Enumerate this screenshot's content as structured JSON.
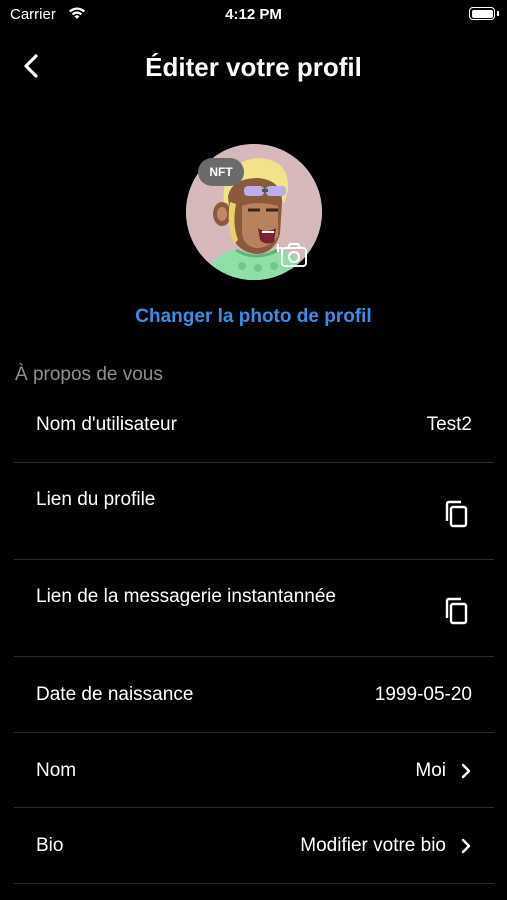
{
  "status": {
    "carrier": "Carrier",
    "time": "4:12 PM"
  },
  "nav": {
    "title": "Éditer votre profil"
  },
  "avatar": {
    "badge": "NFT",
    "change_label": "Changer la photo de profil"
  },
  "section": {
    "header": "À propos de vous"
  },
  "rows": [
    {
      "label": "Nom d'utilisateur",
      "value": "Test2"
    },
    {
      "label": "Lien du profile"
    },
    {
      "label": "Lien de la messagerie instantannée"
    },
    {
      "label": "Date de naissance",
      "value": "1999-05-20"
    },
    {
      "label": "Nom",
      "value": "Moi"
    },
    {
      "label": "Bio",
      "value": "Modifier votre bio"
    }
  ],
  "colors": {
    "accent": "#3a8ee6",
    "background": "#000000",
    "separator": "#2c2c2e",
    "secondary_text": "#8e8e93"
  }
}
